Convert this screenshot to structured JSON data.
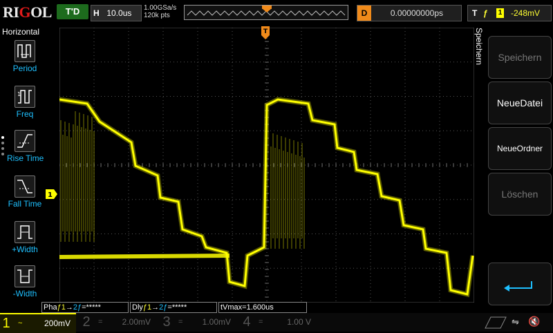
{
  "header": {
    "logo": "RIGOL",
    "run_state": "T'D",
    "timebase_key": "H",
    "timebase_value": "10.0us",
    "sample_rate": "1.00GSa/s",
    "memory_depth": "120k pts",
    "delay_key": "D",
    "delay_value": "0.00000000ps",
    "trigger_key": "T",
    "trigger_edge": "ƒ",
    "trigger_source": "1",
    "trigger_level": "-248mV"
  },
  "left_panel": {
    "title": "Horizontal",
    "items": [
      {
        "label": "Period",
        "icon": "period-icon"
      },
      {
        "label": "Freq",
        "icon": "freq-icon"
      },
      {
        "label": "Rise Time",
        "icon": "rise-time-icon"
      },
      {
        "label": "Fall Time",
        "icon": "fall-time-icon"
      },
      {
        "label": "+Width",
        "icon": "pos-width-icon"
      },
      {
        "label": "-Width",
        "icon": "neg-width-icon"
      }
    ]
  },
  "right_panel": {
    "title": "Speichern",
    "buttons": [
      {
        "label": "Speichern",
        "enabled": false
      },
      {
        "label": "NeueDatei",
        "enabled": true
      },
      {
        "label": "NeueOrdner",
        "enabled": true
      },
      {
        "label": "Löschen",
        "enabled": false
      },
      {
        "label": "",
        "icon": "enter-icon",
        "enabled": true
      }
    ]
  },
  "markers": {
    "ch1_offset": "1",
    "trigger_level_marker": "T",
    "trigger_pos_marker": "T"
  },
  "measurements": {
    "phase": {
      "prefix": "Pha",
      "edge1": "ƒ",
      "ch1": "1",
      "arrow": "→",
      "ch2": "2",
      "edge2": "ƒ",
      "value": "=*****"
    },
    "delay": {
      "prefix": "Dly",
      "edge1": "ƒ",
      "ch1": "1",
      "arrow": "→",
      "ch2": "2",
      "edge2": "ƒ",
      "value": "=*****"
    },
    "tvmax": "tVmax=1.600us"
  },
  "channels": [
    {
      "num": "1",
      "coupling": "~",
      "scale": "200mV",
      "active": true
    },
    {
      "num": "2",
      "coupling": "=",
      "scale": "2.00mV",
      "active": false
    },
    {
      "num": "3",
      "coupling": "=",
      "scale": "1.00mV",
      "active": false
    },
    {
      "num": "4",
      "coupling": "=",
      "scale": "1.00 V",
      "active": false
    }
  ],
  "status": {
    "usb_icon": "usb-icon",
    "mute_icon": "speaker-mute-icon"
  },
  "colors": {
    "ch1": "#ffff00",
    "ch2": "#1ec0ff",
    "ch3": "#ff00ff",
    "ch4": "#3355ff",
    "trigger": "#f08a1a",
    "run": "#1d6b1d"
  }
}
